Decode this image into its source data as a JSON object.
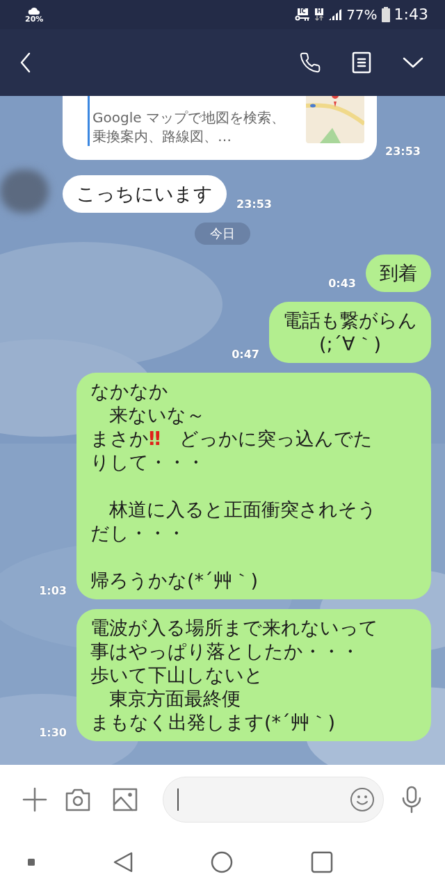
{
  "status_bar": {
    "weather": "20%",
    "badge_1": "IC",
    "badge_2": "H",
    "battery": "77%",
    "time": "1:43"
  },
  "messages": [
    {
      "kind": "incoming_card",
      "description": "Google マップで地図を検索、乗換案内、路線図、…",
      "time": "23:53"
    },
    {
      "kind": "incoming_text",
      "avatar": true,
      "paragraphs": [
        [
          {
            "text": "こっちにいます"
          }
        ]
      ],
      "time": "23:53"
    },
    {
      "kind": "date",
      "text": "今日"
    },
    {
      "kind": "outgoing_text",
      "paragraphs": [
        [
          {
            "text": "到着"
          }
        ]
      ],
      "time": "0:43"
    },
    {
      "kind": "outgoing_text",
      "centered": true,
      "paragraphs": [
        [
          {
            "text": "電話も繋がらん"
          },
          {
            "text": "(;´∀｀)"
          }
        ]
      ],
      "time": "0:47"
    },
    {
      "kind": "outgoing_text",
      "paragraphs": [
        [
          {
            "text": "なかなか"
          },
          {
            "text": "　来ないな～"
          },
          {
            "segments": [
              {
                "kind": "text",
                "text": "まさか"
              },
              {
                "kind": "emoji",
                "text": "‼"
              },
              {
                "kind": "text",
                "text": "　どっかに突っ込んでた"
              }
            ]
          },
          {
            "text": "りして・・・"
          }
        ],
        [
          {
            "text": "　林道に入ると正面衝突されそう"
          },
          {
            "text": "だし・・・"
          }
        ],
        [
          {
            "text": "帰ろうかな(*´艸｀)"
          }
        ]
      ],
      "time": "1:03"
    },
    {
      "kind": "outgoing_text",
      "paragraphs": [
        [
          {
            "text": "電波が入る場所まで来れないって"
          },
          {
            "text": "事はやっぱり落としたか・・・"
          },
          {
            "text": "歩いて下山しないと"
          },
          {
            "text": "　東京方面最終便"
          },
          {
            "text": "まもなく出発します(*´艸｀)"
          }
        ]
      ],
      "time": "1:30"
    }
  ]
}
